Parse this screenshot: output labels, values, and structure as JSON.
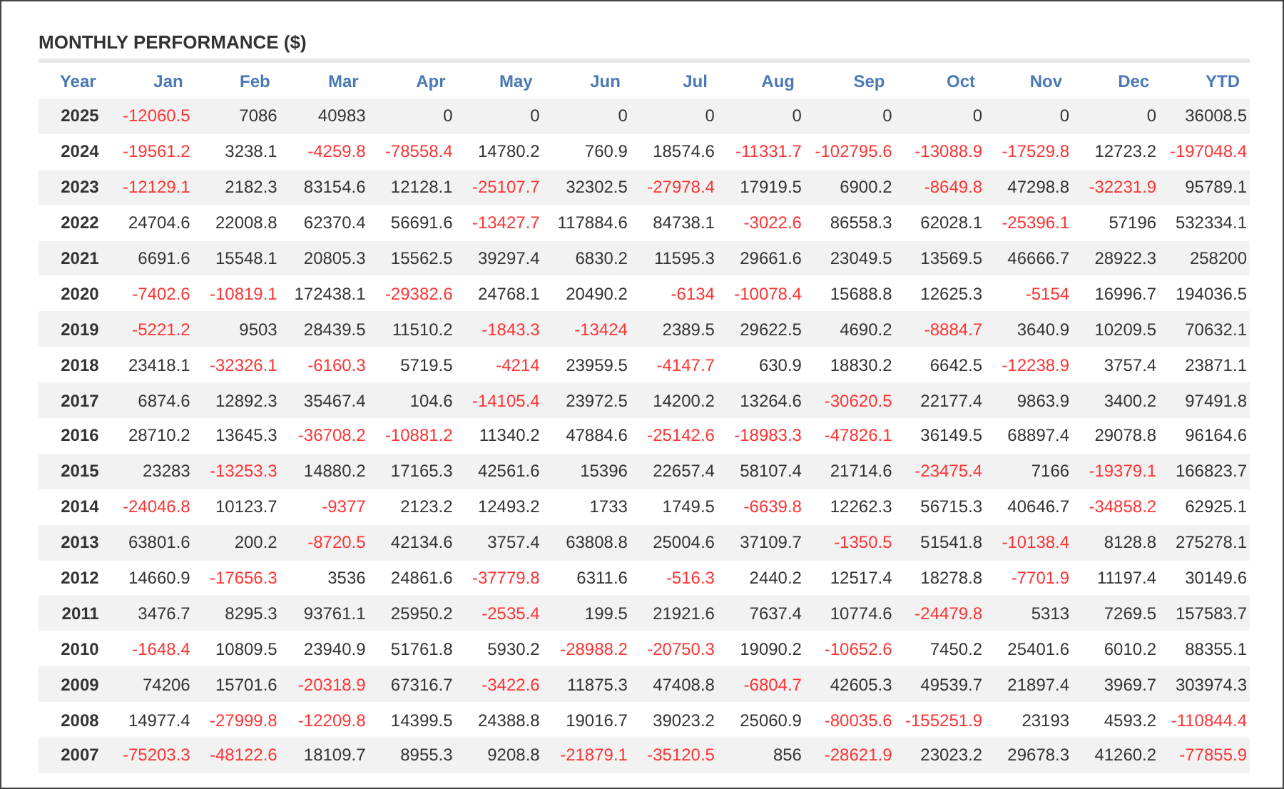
{
  "title": "MONTHLY PERFORMANCE ($)",
  "table": {
    "columns": [
      "Year",
      "Jan",
      "Feb",
      "Mar",
      "Apr",
      "May",
      "Jun",
      "Jul",
      "Aug",
      "Sep",
      "Oct",
      "Nov",
      "Dec",
      "YTD"
    ],
    "rows": [
      {
        "cells": [
          "2025",
          "-12060.5",
          "7086",
          "40983",
          "0",
          "0",
          "0",
          "0",
          "0",
          "0",
          "0",
          "0",
          "0",
          "36008.5"
        ]
      },
      {
        "cells": [
          "2024",
          "-19561.2",
          "3238.1",
          "-4259.8",
          "-78558.4",
          "14780.2",
          "760.9",
          "18574.6",
          "-11331.7",
          "-102795.6",
          "-13088.9",
          "-17529.8",
          "12723.2",
          "-197048.4"
        ]
      },
      {
        "cells": [
          "2023",
          "-12129.1",
          "2182.3",
          "83154.6",
          "12128.1",
          "-25107.7",
          "32302.5",
          "-27978.4",
          "17919.5",
          "6900.2",
          "-8649.8",
          "47298.8",
          "-32231.9",
          "95789.1"
        ]
      },
      {
        "cells": [
          "2022",
          "24704.6",
          "22008.8",
          "62370.4",
          "56691.6",
          "-13427.7",
          "117884.6",
          "84738.1",
          "-3022.6",
          "86558.3",
          "62028.1",
          "-25396.1",
          "57196",
          "532334.1"
        ]
      },
      {
        "cells": [
          "2021",
          "6691.6",
          "15548.1",
          "20805.3",
          "15562.5",
          "39297.4",
          "6830.2",
          "11595.3",
          "29661.6",
          "23049.5",
          "13569.5",
          "46666.7",
          "28922.3",
          "258200"
        ]
      },
      {
        "cells": [
          "2020",
          "-7402.6",
          "-10819.1",
          "172438.1",
          "-29382.6",
          "24768.1",
          "20490.2",
          "-6134",
          "-10078.4",
          "15688.8",
          "12625.3",
          "-5154",
          "16996.7",
          "194036.5"
        ]
      },
      {
        "cells": [
          "2019",
          "-5221.2",
          "9503",
          "28439.5",
          "11510.2",
          "-1843.3",
          "-13424",
          "2389.5",
          "29622.5",
          "4690.2",
          "-8884.7",
          "3640.9",
          "10209.5",
          "70632.1"
        ]
      },
      {
        "cells": [
          "2018",
          "23418.1",
          "-32326.1",
          "-6160.3",
          "5719.5",
          "-4214",
          "23959.5",
          "-4147.7",
          "630.9",
          "18830.2",
          "6642.5",
          "-12238.9",
          "3757.4",
          "23871.1"
        ]
      },
      {
        "cells": [
          "2017",
          "6874.6",
          "12892.3",
          "35467.4",
          "104.6",
          "-14105.4",
          "23972.5",
          "14200.2",
          "13264.6",
          "-30620.5",
          "22177.4",
          "9863.9",
          "3400.2",
          "97491.8"
        ]
      },
      {
        "cells": [
          "2016",
          "28710.2",
          "13645.3",
          "-36708.2",
          "-10881.2",
          "11340.2",
          "47884.6",
          "-25142.6",
          "-18983.3",
          "-47826.1",
          "36149.5",
          "68897.4",
          "29078.8",
          "96164.6"
        ]
      },
      {
        "cells": [
          "2015",
          "23283",
          "-13253.3",
          "14880.2",
          "17165.3",
          "42561.6",
          "15396",
          "22657.4",
          "58107.4",
          "21714.6",
          "-23475.4",
          "7166",
          "-19379.1",
          "166823.7"
        ]
      },
      {
        "cells": [
          "2014",
          "-24046.8",
          "10123.7",
          "-9377",
          "2123.2",
          "12493.2",
          "1733",
          "1749.5",
          "-6639.8",
          "12262.3",
          "56715.3",
          "40646.7",
          "-34858.2",
          "62925.1"
        ]
      },
      {
        "cells": [
          "2013",
          "63801.6",
          "200.2",
          "-8720.5",
          "42134.6",
          "3757.4",
          "63808.8",
          "25004.6",
          "37109.7",
          "-1350.5",
          "51541.8",
          "-10138.4",
          "8128.8",
          "275278.1"
        ]
      },
      {
        "cells": [
          "2012",
          "14660.9",
          "-17656.3",
          "3536",
          "24861.6",
          "-37779.8",
          "6311.6",
          "-516.3",
          "2440.2",
          "12517.4",
          "18278.8",
          "-7701.9",
          "11197.4",
          "30149.6"
        ]
      },
      {
        "cells": [
          "2011",
          "3476.7",
          "8295.3",
          "93761.1",
          "25950.2",
          "-2535.4",
          "199.5",
          "21921.6",
          "7637.4",
          "10774.6",
          "-24479.8",
          "5313",
          "7269.5",
          "157583.7"
        ]
      },
      {
        "cells": [
          "2010",
          "-1648.4",
          "10809.5",
          "23940.9",
          "51761.8",
          "5930.2",
          "-28988.2",
          "-20750.3",
          "19090.2",
          "-10652.6",
          "7450.2",
          "25401.6",
          "6010.2",
          "88355.1"
        ]
      },
      {
        "cells": [
          "2009",
          "74206",
          "15701.6",
          "-20318.9",
          "67316.7",
          "-3422.6",
          "11875.3",
          "47408.8",
          "-6804.7",
          "42605.3",
          "49539.7",
          "21897.4",
          "3969.7",
          "303974.3"
        ]
      },
      {
        "cells": [
          "2008",
          "14977.4",
          "-27999.8",
          "-12209.8",
          "14399.5",
          "24388.8",
          "19016.7",
          "39023.2",
          "25060.9",
          "-80035.6",
          "-155251.9",
          "23193",
          "4593.2",
          "-110844.4"
        ]
      },
      {
        "cells": [
          "2007",
          "-75203.3",
          "-48122.6",
          "18109.7",
          "8955.3",
          "9208.8",
          "-21879.1",
          "-35120.5",
          "856",
          "-28621.9",
          "23023.2",
          "29678.3",
          "41260.2",
          "-77855.9"
        ]
      }
    ]
  }
}
